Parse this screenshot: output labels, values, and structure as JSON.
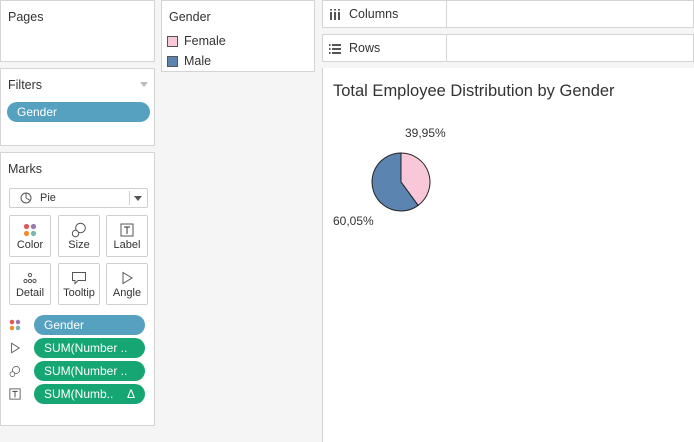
{
  "pages": {
    "title": "Pages"
  },
  "filters": {
    "title": "Filters",
    "items": [
      {
        "label": "Gender"
      }
    ]
  },
  "marks": {
    "title": "Marks",
    "type_select": "Pie",
    "buttons": [
      {
        "label": "Color",
        "icon": "color-icon"
      },
      {
        "label": "Size",
        "icon": "size-icon"
      },
      {
        "label": "Label",
        "icon": "label-icon"
      },
      {
        "label": "Detail",
        "icon": "detail-icon"
      },
      {
        "label": "Tooltip",
        "icon": "tooltip-icon"
      },
      {
        "label": "Angle",
        "icon": "angle-icon"
      }
    ],
    "fields": [
      {
        "label": "Gender",
        "icon": "color-icon",
        "color": "#56a1bf"
      },
      {
        "label": "SUM(Number ..",
        "icon": "angle-icon",
        "color": "#15a673"
      },
      {
        "label": "SUM(Number ..",
        "icon": "size-icon",
        "color": "#15a673"
      },
      {
        "label": "SUM(Numb..",
        "icon": "label-icon",
        "color": "#15a673",
        "badge": "Δ"
      }
    ]
  },
  "legend": {
    "title": "Gender",
    "items": [
      {
        "label": "Female",
        "color": "#f8c8d8"
      },
      {
        "label": "Male",
        "color": "#5b84b1"
      }
    ]
  },
  "shelves": {
    "columns_label": "Columns",
    "rows_label": "Rows"
  },
  "view": {
    "title": "Total Employee Distribution by Gender",
    "label_female": "39,95%",
    "label_male": "60,05%"
  },
  "chart_data": {
    "type": "pie",
    "title": "Total Employee Distribution by Gender",
    "slices": [
      {
        "name": "Female",
        "value": 39.95,
        "label": "39,95%",
        "color": "#f8c8d8"
      },
      {
        "name": "Male",
        "value": 60.05,
        "label": "60,05%",
        "color": "#5b84b1"
      }
    ]
  }
}
